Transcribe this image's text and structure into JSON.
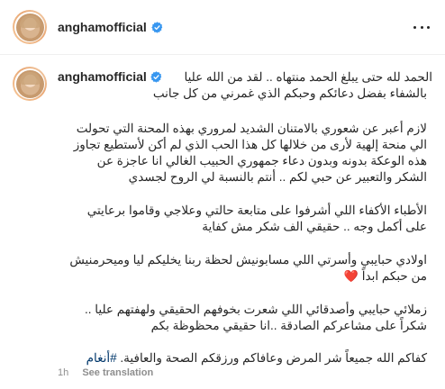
{
  "header": {
    "username": "anghamofficial",
    "verified_icon": "verified-badge-icon",
    "more_icon": "more-options-icon"
  },
  "caption": {
    "username": "anghamofficial",
    "line1": "الحمد لله حتى يبلغ الحمد منتهاه .. لقد من الله عليا",
    "line2": "بالشفاء بفضل دعائكم وحبكم الذي غمرني من كل جانب",
    "para2_l1": "لازم أعبر عن شعوري بالامتنان الشديد لمروري بهذه المحنة التي تحولت",
    "para2_l2": "الي منحة إلهية لأرى من خلالها كل هذا الحب الذي لم أكن لأستطيع تجاوز",
    "para2_l3": "هذه الوعكة بدونه وبدون دعاء جمهوري الحبيب الغالي انا عاجزة عن",
    "para2_l4": "الشكر والتعبير عن حبي لكم .. أنتم بالنسبة لي الروح لجسدي",
    "para3_l1": "الأطباء الأكفاء اللي أشرفوا على متابعة حالتي وعلاجي وقاموا برعايتي",
    "para3_l2": "على أكمل وجه .. حقيقي الف شكر مش كفاية",
    "para4_l1": "اولادي حبايبي وأسرتي اللي مسابونيش لحظة ربنا يخليكم ليا وميحرمنيش",
    "para4_l2": "من حبكم ابداً",
    "para4_heart": "❤️",
    "para5_l1": "زملائي حبايبي وأصدقائي اللي شعرت بخوفهم الحقيقي ولهفتهم عليا ..",
    "para5_l2": "شكراً على مشاعركم الصادقة ..انا حقيقي محظوظة بكم",
    "para6_text": "كفاكم الله جميعاً شر المرض وعافاكم ورزقكم الصحة والعافية.",
    "para6_hashtag": "#أنغام"
  },
  "meta": {
    "time": "1h",
    "see_translation": "See translation"
  },
  "colors": {
    "verified": "#3897f0",
    "hashtag": "#00376b",
    "muted": "#8e8e8e",
    "heart": "#ed4956"
  }
}
